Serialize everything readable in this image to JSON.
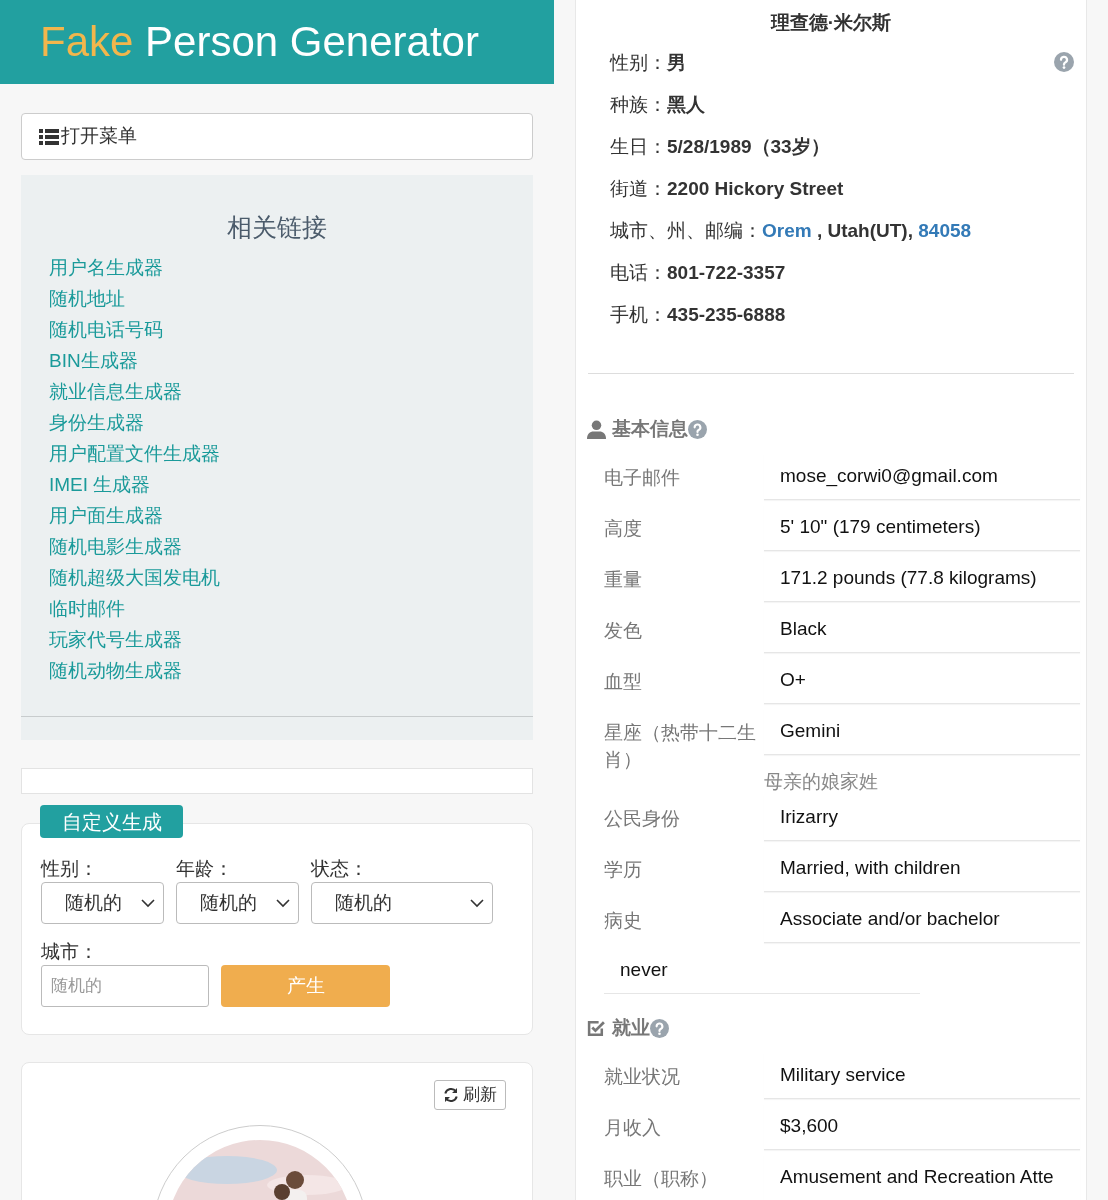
{
  "header": {
    "logo_accent": "Fake",
    "logo_rest": "Person Generator"
  },
  "menu_button": {
    "label": "打开菜单"
  },
  "related_links": {
    "title": "相关链接",
    "items": [
      "用户名生成器",
      "随机地址",
      "随机电话号码",
      "BIN生成器",
      "就业信息生成器",
      "身份生成器",
      "用户配置文件生成器",
      "IMEI 生成器",
      "用户面生成器",
      "随机电影生成器",
      "随机超级大国发电机",
      "临时邮件",
      "玩家代号生成器",
      "随机动物生成器"
    ]
  },
  "custom_form": {
    "tab": "自定义生成",
    "selects": [
      {
        "label": "性别：",
        "value": "随机的"
      },
      {
        "label": "年龄：",
        "value": "随机的"
      },
      {
        "label": "状态：",
        "value": "随机的"
      }
    ],
    "city": {
      "label": "城市：",
      "placeholder": "随机的"
    },
    "submit": "产生"
  },
  "photo_card": {
    "refresh": "刷新"
  },
  "person": {
    "name": "理查德·米尔斯",
    "facts": [
      {
        "label": "性别：",
        "parts": [
          {
            "text": "男",
            "link": false
          }
        ]
      },
      {
        "label": "种族：",
        "parts": [
          {
            "text": "黑人",
            "link": false
          }
        ]
      },
      {
        "label": "生日：",
        "parts": [
          {
            "text": "5/28/1989（33岁）",
            "link": false
          }
        ]
      },
      {
        "label": "街道：",
        "parts": [
          {
            "text": "2200 Hickory Street",
            "link": false
          }
        ]
      },
      {
        "label": "城市、州、邮编：",
        "parts": [
          {
            "text": "Orem",
            "link": true
          },
          {
            "text": " , Utah(UT), ",
            "link": false
          },
          {
            "text": "84058",
            "link": true
          }
        ]
      },
      {
        "label": "电话：",
        "parts": [
          {
            "text": "801-722-3357",
            "link": false
          }
        ]
      },
      {
        "label": "手机：",
        "parts": [
          {
            "text": "435-235-6888",
            "link": false
          }
        ]
      }
    ]
  },
  "sections": [
    {
      "title": "基本信息",
      "rows": [
        {
          "kind": "pair",
          "label": "电子邮件",
          "value": "mose_corwi0@gmail.com"
        },
        {
          "kind": "pair",
          "label": "高度",
          "value": "5' 10\" (179 centimeters)"
        },
        {
          "kind": "pair",
          "label": "重量",
          "value": "171.2 pounds (77.8 kilograms)"
        },
        {
          "kind": "pair",
          "label": "发色",
          "value": "Black"
        },
        {
          "kind": "pair",
          "label": "血型",
          "value": "O+"
        },
        {
          "kind": "pair",
          "label": "星座（热带十二生肖）",
          "value": "Gemini"
        },
        {
          "kind": "stray_label",
          "label": "母亲的娘家姓"
        },
        {
          "kind": "pair",
          "label": "公民身份",
          "value": "Irizarry"
        },
        {
          "kind": "pair",
          "label": "学历",
          "value": "Married, with children"
        },
        {
          "kind": "pair",
          "label": "病史",
          "value": "Associate and/or bachelor"
        },
        {
          "kind": "stray_value",
          "value": "never"
        }
      ]
    },
    {
      "title": "就业",
      "rows": [
        {
          "kind": "pair",
          "label": "就业状况",
          "value": "Military service"
        },
        {
          "kind": "pair",
          "label": "月收入",
          "value": "$3,600"
        },
        {
          "kind": "pair",
          "label": "职业（职称）",
          "value": "Amusement and Recreation Atte"
        }
      ]
    }
  ]
}
